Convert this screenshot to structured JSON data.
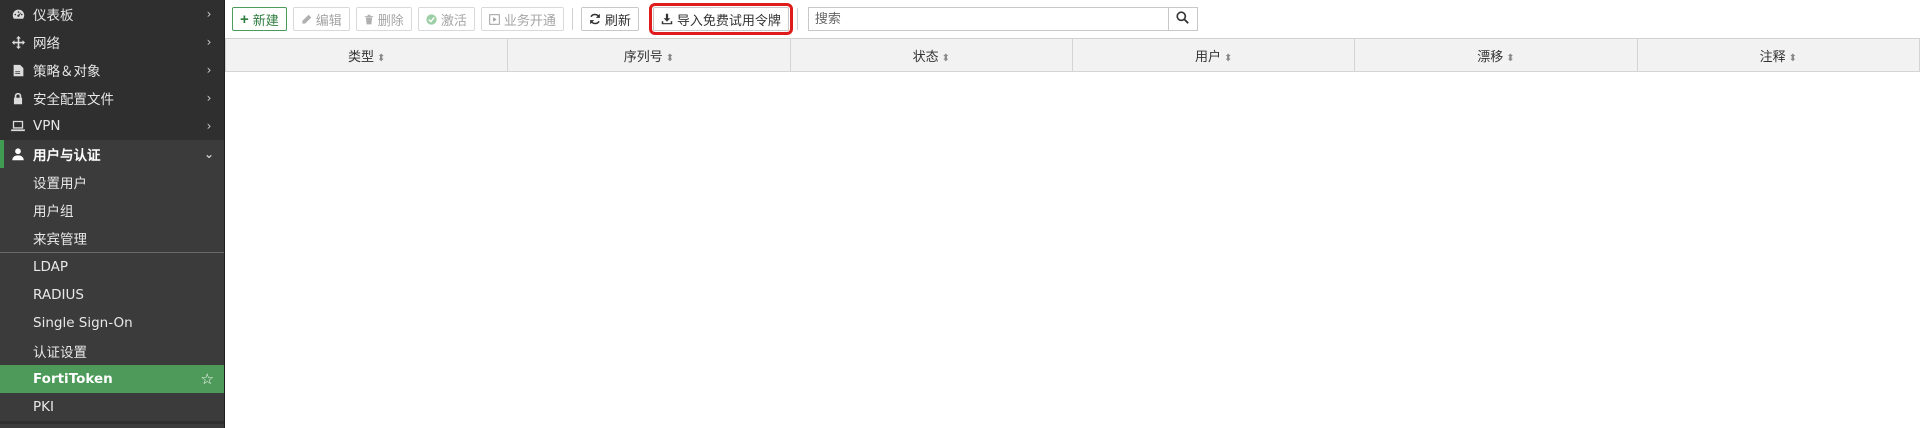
{
  "sidebar": {
    "items": [
      {
        "label": "仪表板",
        "icon": "dashboard-icon"
      },
      {
        "label": "网络",
        "icon": "network-icon"
      },
      {
        "label": "策略＆对象",
        "icon": "policy-icon"
      },
      {
        "label": "安全配置文件",
        "icon": "lock-icon"
      },
      {
        "label": "VPN",
        "icon": "laptop-icon"
      },
      {
        "label": "用户与认证",
        "icon": "user-icon",
        "expanded": true
      }
    ],
    "sub_items": [
      {
        "label": "设置用户"
      },
      {
        "label": "用户组"
      },
      {
        "label": "来宾管理"
      },
      {
        "label": "LDAP"
      },
      {
        "label": "RADIUS"
      },
      {
        "label": "Single Sign-On"
      },
      {
        "label": "认证设置"
      },
      {
        "label": "FortiToken",
        "active": true
      },
      {
        "label": "PKI"
      }
    ]
  },
  "toolbar": {
    "new_label": "新建",
    "edit_label": "编辑",
    "delete_label": "删除",
    "activate_label": "激活",
    "provision_label": "业务开通",
    "refresh_label": "刷新",
    "import_label": "导入免费试用令牌"
  },
  "search": {
    "placeholder": "搜索"
  },
  "table": {
    "columns": [
      "类型",
      "序列号",
      "状态",
      "用户",
      "漂移",
      "注释"
    ]
  },
  "colors": {
    "sidebar_bg": "#2f2f2f",
    "accent_green": "#4e9a5a",
    "highlight_red": "#e01b1b"
  }
}
